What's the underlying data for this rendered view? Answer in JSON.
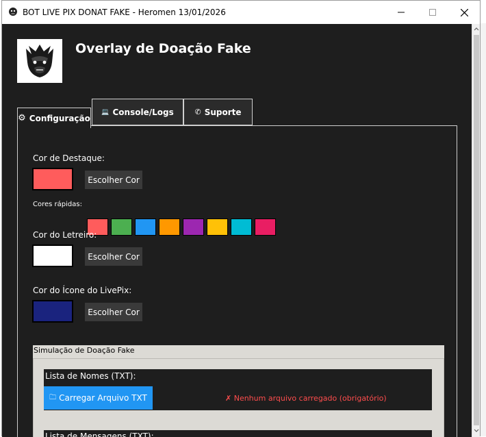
{
  "window": {
    "title": "BOT LIVE PIX DONAT FAKE - Heromen 13/01/2026",
    "minimize": "—",
    "maximize": "☐",
    "close": "✕"
  },
  "header": {
    "title": "Overlay de Doação Fake",
    "logo_icon": "gorilla-logo"
  },
  "tabs": [
    {
      "label": "Configuração",
      "icon": "gear-icon",
      "glyph": "⚙",
      "active": true
    },
    {
      "label": "Console/Logs",
      "icon": "laptop-icon",
      "glyph": "💻",
      "active": false
    },
    {
      "label": "Suporte",
      "icon": "phone-icon",
      "glyph": "✆",
      "active": false
    }
  ],
  "config": {
    "highlight_color": {
      "label": "Cor de Destaque:",
      "value": "#ff5c5c",
      "button": "Escolher Cor"
    },
    "quick_colors": {
      "label": "Cores rápidas:",
      "colors": [
        "#ff5c5c",
        "#4caf50",
        "#2196f3",
        "#ff9800",
        "#9c27b0",
        "#ffc107",
        "#00bcd4",
        "#e91e63"
      ]
    },
    "marquee_color": {
      "label": "Cor do Letreiro:",
      "value": "#ffffff",
      "button": "Escolher Cor"
    },
    "livepix_icon_color": {
      "label": "Cor do Ícone do LivePix:",
      "value": "#1a237e",
      "button": "Escolher Cor"
    }
  },
  "simulation": {
    "title": "Simulação de Doação Fake",
    "names_label": "Lista de Nomes (TXT):",
    "load_button": "Carregar Arquivo TXT",
    "folder_glyph": "🗀",
    "no_file_status": "✗ Nenhum arquivo carregado (obrigatório)",
    "messages_label": "Lista de Mensagens (TXT):"
  },
  "colors": {
    "background": "#1e1e1e",
    "accent_blue": "#2196f3",
    "error_red": "#ff4d4d"
  }
}
